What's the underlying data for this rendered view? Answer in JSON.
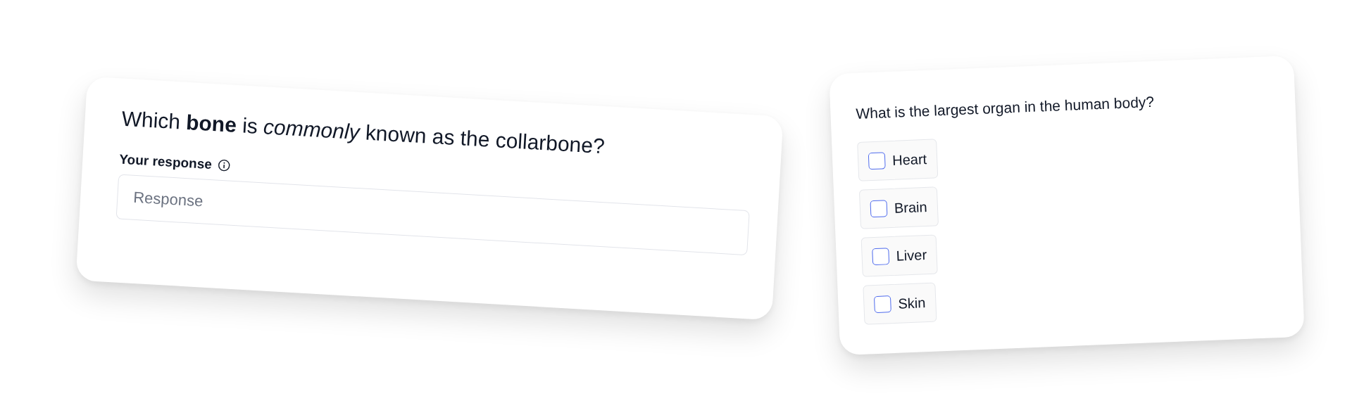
{
  "response_card": {
    "question": "Which **bone** is *commonly* known as the collarbone?",
    "label": "Your response",
    "input": {
      "placeholder": "Response"
    }
  },
  "choice_card": {
    "question": "What is the largest organ in the human body?",
    "options": [
      {
        "label": "Heart",
        "checked": false
      },
      {
        "label": "Brain",
        "checked": false
      },
      {
        "label": "Liver",
        "checked": false
      },
      {
        "label": "Skin",
        "checked": false
      }
    ]
  }
}
